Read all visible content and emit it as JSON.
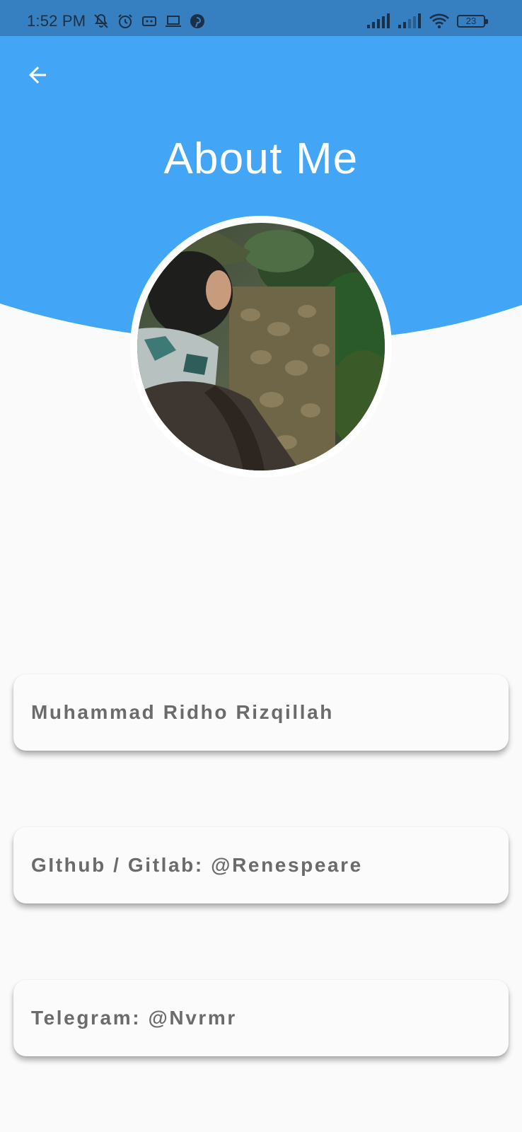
{
  "status_bar": {
    "time": "1:52 PM",
    "battery_level": "23",
    "left_icons": [
      "notifications-off-icon",
      "alarm-icon",
      "cast-icon",
      "laptop-icon",
      "pinterest-icon"
    ],
    "right_icons": [
      "signal-icon",
      "signal-secondary-icon",
      "wifi-icon",
      "battery-icon"
    ]
  },
  "header": {
    "back_icon": "arrow-left-icon",
    "title": "About Me",
    "color": "#42a5f5"
  },
  "profile": {
    "avatar_icon": "profile-photo"
  },
  "cards": {
    "name": "Muhammad Ridho Rizqillah",
    "git": "GIthub / Gitlab: @Renespeare",
    "telegram": "Telegram: @Nvrmr"
  },
  "colors": {
    "status_bar": "#3680c2",
    "header": "#42a5f5",
    "background": "#fafafa",
    "card_text": "#6b6b6b"
  }
}
